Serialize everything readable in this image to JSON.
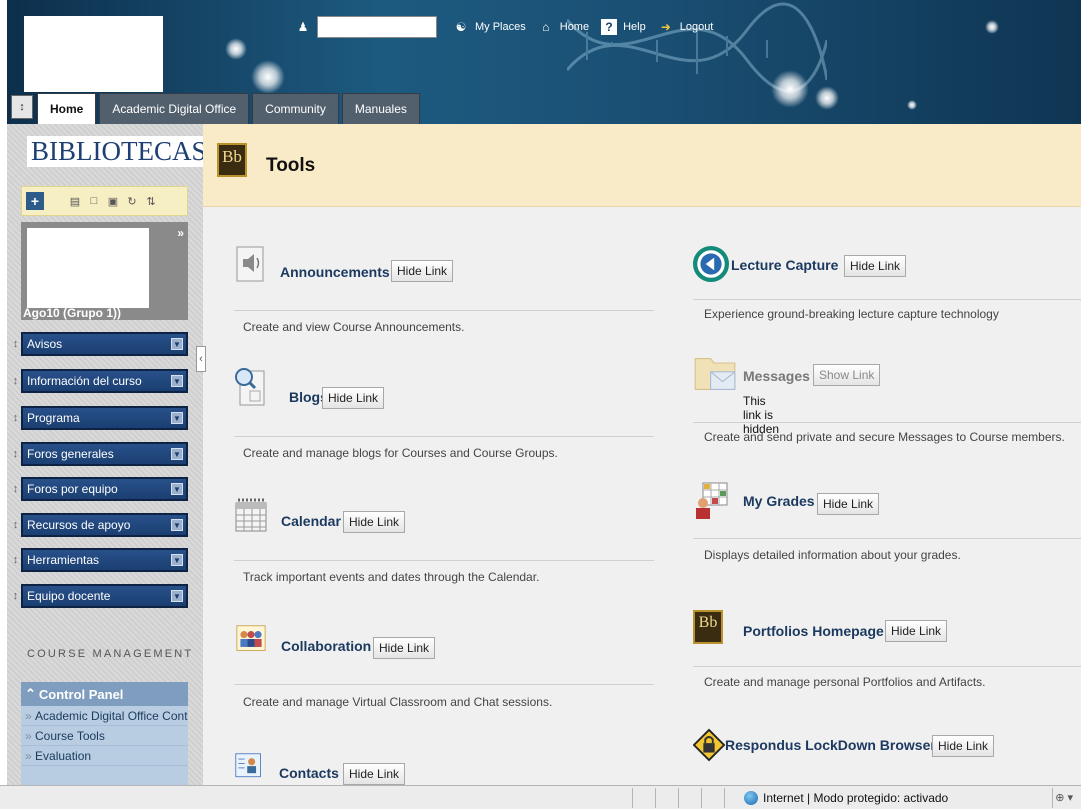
{
  "header": {
    "util_links": [
      {
        "label": "My Places",
        "icon": "places-icon"
      },
      {
        "label": "Home",
        "icon": "home-icon"
      },
      {
        "label": "Help",
        "icon": "help-icon"
      },
      {
        "label": "Logout",
        "icon": "logout-icon"
      }
    ],
    "help_glyph": "?",
    "tabs": [
      "Home",
      "Academic Digital Office",
      "Community",
      "Manuales"
    ]
  },
  "sidebar": {
    "brand": "BIBLIOTECAS",
    "course_name": "Ago10 (Grupo 1))",
    "menu": [
      "Avisos",
      "Información del curso",
      "Programa",
      "Foros generales",
      "Foros por equipo",
      "Recursos de apoyo",
      "Herramientas",
      "Equipo docente"
    ],
    "course_management": "COURSE MANAGEMENT",
    "control_panel": "Control Panel",
    "cp_items": [
      "Academic Digital Office Conte",
      "Course Tools",
      "Evaluation"
    ]
  },
  "main": {
    "title": "Tools",
    "left_tools": [
      {
        "name": "Announcements",
        "button": "Hide Link",
        "desc": "Create and view Course Announcements."
      },
      {
        "name": "Blogs",
        "button": "Hide Link",
        "desc": "Create and manage blogs for Courses and Course Groups."
      },
      {
        "name": "Calendar",
        "button": "Hide Link",
        "desc": "Track important events and dates through the Calendar."
      },
      {
        "name": "Collaboration",
        "button": "Hide Link",
        "desc": "Create and manage Virtual Classroom and Chat sessions."
      },
      {
        "name": "Contacts",
        "button": "Hide Link",
        "desc": ""
      }
    ],
    "right_tools": [
      {
        "name": "Lecture Capture",
        "button": "Hide Link",
        "desc": "Experience ground-breaking lecture capture technology"
      },
      {
        "name": "Messages",
        "button": "Show Link",
        "note": "This link is hidden",
        "desc": "Create and send private and secure Messages to Course members."
      },
      {
        "name": "My Grades",
        "button": "Hide Link",
        "desc": "Displays detailed information about your grades."
      },
      {
        "name": "Portfolios Homepage",
        "button": "Hide Link",
        "desc": "Create and manage personal Portfolios and Artifacts."
      },
      {
        "name": "Respondus LockDown Browser",
        "button": "Hide Link",
        "desc": ""
      }
    ]
  },
  "statusbar": {
    "text": "Internet | Modo protegido: activado",
    "zoom": "⊕ ▾"
  }
}
